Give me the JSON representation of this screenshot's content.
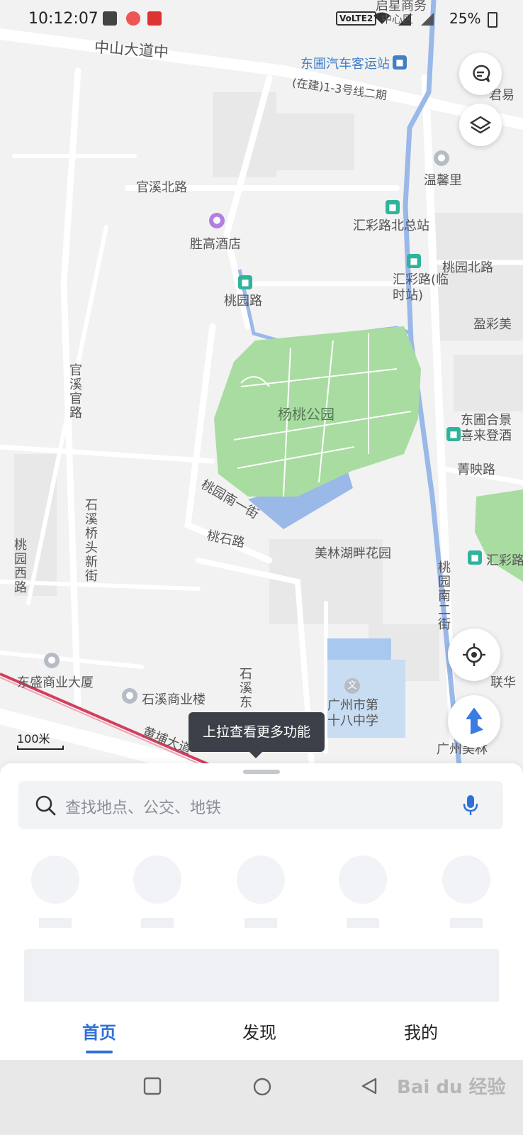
{
  "status_bar": {
    "time": "10:12:07",
    "network_badge": "VoLTE2",
    "battery": "25%"
  },
  "map": {
    "road_labels": [
      "中山大道中",
      "官溪北路",
      "桃园北路",
      "桃园南一街",
      "桃石路",
      "黄埔大道",
      "菁映路",
      "(在建)1-3号线二期"
    ],
    "vertical_road_labels": [
      "官溪官路",
      "石溪桥头新街",
      "桃园西路",
      "桃园南二街",
      "石溪东"
    ],
    "park_label": "杨桃公园",
    "poi_labels": [
      "胜高酒店",
      "温馨里",
      "美林湖畔花园",
      "东盛商业大厦",
      "石溪商业楼",
      "广州市第十八中学",
      "盈彩美",
      "东圃合景喜来登酒",
      "启星商务",
      "君易",
      "联华",
      "广州美林",
      "中心区"
    ],
    "station_labels": [
      "东圃汽车客运站",
      "汇彩路北总站",
      "汇彩路(临时站)",
      "桃园路",
      "汇彩路"
    ],
    "scale_label": "100米"
  },
  "controls": {
    "message_icon": "message-icon",
    "layers_icon": "layers-icon",
    "locate_icon": "locate-icon",
    "route_icon": "route-icon"
  },
  "tooltip": "上拉查看更多功能",
  "search": {
    "placeholder": "查找地点、公交、地铁"
  },
  "tabs": [
    "首页",
    "发现",
    "我的"
  ],
  "active_tab": "首页",
  "watermark": "Bai du 经验",
  "colors": {
    "accent": "#2f6fd6",
    "park": "#a8dca0",
    "water": "#9ab8e8",
    "bus_station": "#2fb49c",
    "metro_line": "#d0415f"
  }
}
